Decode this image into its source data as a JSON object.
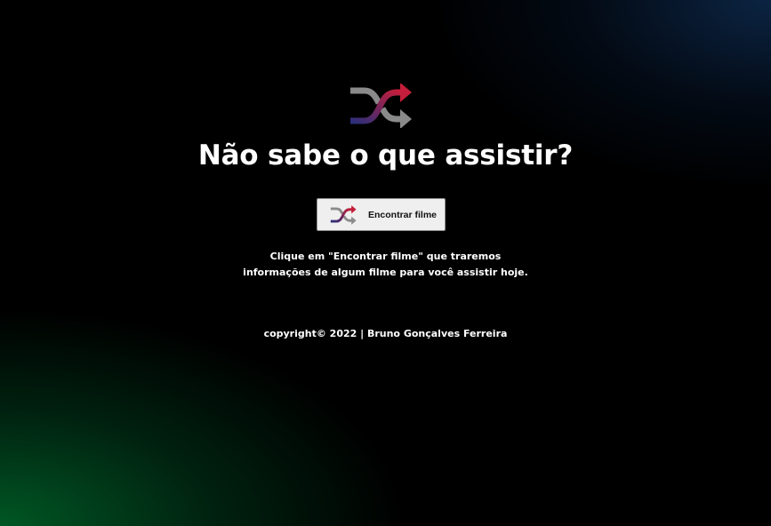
{
  "logo": {
    "icon": "shuffle-icon",
    "colors": {
      "arrow_top": "#c41e3a",
      "arrow_bottom": "#8a8a8a",
      "cross": "#2b2f7a"
    }
  },
  "header": {
    "title": "Não sabe o que assistir?"
  },
  "action": {
    "button_label": "Encontrar filme",
    "button_icon": "shuffle-icon"
  },
  "description": {
    "line1": "Clique em \"Encontrar filme\" que traremos",
    "line2": "informações de algum filme para você assistir hoje."
  },
  "footer": {
    "copyright": "copyright© 2022 | Bruno Gonçalves Ferreira"
  },
  "colors": {
    "background": "#000000",
    "glow_bottom_left": "#005c26",
    "glow_top_right": "#0c2646",
    "text": "#ffffff",
    "button_bg": "#efefef"
  }
}
